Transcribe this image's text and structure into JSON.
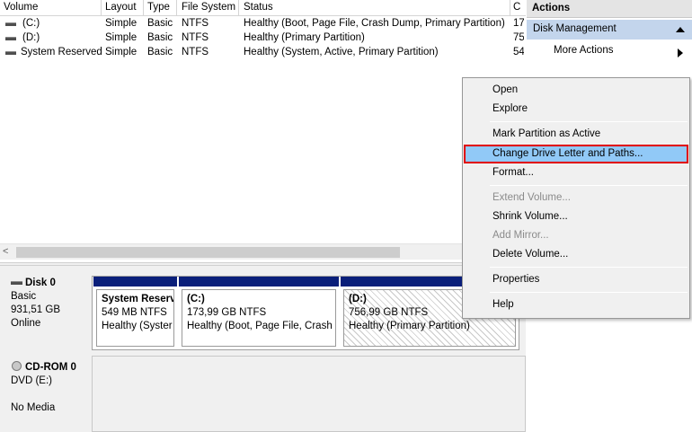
{
  "volume_list": {
    "columns": [
      "Volume",
      "Layout",
      "Type",
      "File System",
      "Status",
      "C"
    ],
    "rows": [
      {
        "volume": "(C:)",
        "layout": "Simple",
        "type": "Basic",
        "fs": "NTFS",
        "status": "Healthy (Boot, Page File, Crash Dump, Primary Partition)",
        "capacity": "17"
      },
      {
        "volume": "(D:)",
        "layout": "Simple",
        "type": "Basic",
        "fs": "NTFS",
        "status": "Healthy (Primary Partition)",
        "capacity": "75"
      },
      {
        "volume": "System Reserved",
        "layout": "Simple",
        "type": "Basic",
        "fs": "NTFS",
        "status": "Healthy (System, Active, Primary Partition)",
        "capacity": "54"
      }
    ],
    "scroll_left_arrow": "<"
  },
  "disk0": {
    "name": "Disk 0",
    "type": "Basic",
    "size": "931,51 GB",
    "state": "Online",
    "partitions": [
      {
        "name": "System Reserv",
        "size": "549 MB NTFS",
        "status": "Healthy (Syster"
      },
      {
        "name": "(C:)",
        "size": "173,99 GB NTFS",
        "status": "Healthy (Boot, Page File, Crash D"
      },
      {
        "name": "(D:)",
        "size": "756,99 GB NTFS",
        "status": "Healthy (Primary Partition)"
      }
    ]
  },
  "cdrom0": {
    "name": "CD-ROM 0",
    "drive": "DVD (E:)",
    "media": "No Media"
  },
  "actions": {
    "title": "Actions",
    "group": "Disk Management",
    "more_actions": "More Actions"
  },
  "context_menu": {
    "items": {
      "open": "Open",
      "explore": "Explore",
      "mark_active": "Mark Partition as Active",
      "change_letter": "Change Drive Letter and Paths...",
      "format": "Format...",
      "extend": "Extend Volume...",
      "shrink": "Shrink Volume...",
      "add_mirror": "Add Mirror...",
      "delete": "Delete Volume...",
      "properties": "Properties",
      "help": "Help"
    }
  },
  "colors": {
    "partition_bar": "#0a1f7a",
    "actions_group_bg": "#c3d5ec",
    "menu_highlight": "#91c9f7",
    "highlight_border": "#e00000"
  }
}
